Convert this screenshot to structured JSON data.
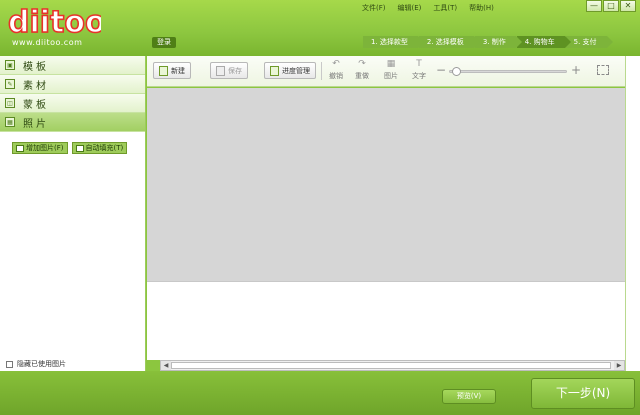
{
  "header": {
    "logo_text": "diitoo",
    "logo_url": "www.diitoo.com",
    "login_label": "登录",
    "menu": [
      {
        "label": "文件(F)"
      },
      {
        "label": "编辑(E)"
      },
      {
        "label": "工具(T)"
      },
      {
        "label": "帮助(H)"
      }
    ],
    "window_controls": {
      "minimize": "—",
      "maximize": "□",
      "close": "✕"
    },
    "steps": [
      {
        "label": "1. 选择款型"
      },
      {
        "label": "2. 选择模板"
      },
      {
        "label": "3. 制作"
      },
      {
        "label": "4. 购物车"
      },
      {
        "label": "5. 支付"
      }
    ]
  },
  "sidebar": {
    "items": [
      {
        "label": "模板",
        "icon": "template-icon"
      },
      {
        "label": "素材",
        "icon": "material-icon"
      },
      {
        "label": "蒙板",
        "icon": "mask-icon"
      },
      {
        "label": "照片",
        "icon": "photo-icon",
        "active": true
      }
    ],
    "add_photo_label": "增加图片(F)",
    "auto_fill_label": "自动填充(T)",
    "hide_used_label": "隐藏已使用图片",
    "hide_used_checked": false
  },
  "toolbar": {
    "new_label": "新建",
    "save_label": "保存",
    "progress_label": "进度管理",
    "undo_label": "撤销",
    "redo_label": "重做",
    "image_label": "图片",
    "text_label": "文字",
    "zoom_level": 0.02
  },
  "footer": {
    "preview_label": "预览(V)",
    "next_label": "下一步(N)"
  },
  "colors": {
    "brand_green": "#8cc63f",
    "dark_green": "#5e9222",
    "canvas_gray": "#d6d6d6",
    "logo_red": "#e8322a"
  }
}
